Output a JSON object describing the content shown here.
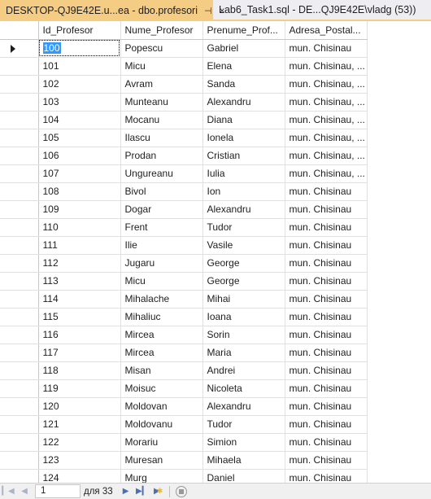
{
  "tabs": [
    {
      "label": "DESKTOP-QJ9E42E.u...ea - dbo.profesori",
      "pin": "⊣",
      "close": "×"
    },
    {
      "label": "Lab6_Task1.sql - DE...QJ9E42E\\vladg (53))"
    }
  ],
  "grid": {
    "columns": [
      "Id_Profesor",
      "Nume_Profesor",
      "Prenume_Prof...",
      "Adresa_Postal..."
    ],
    "rows": [
      [
        "100",
        "Popescu",
        "Gabriel",
        "mun. Chisinau"
      ],
      [
        "101",
        "Micu",
        "Elena",
        "mun. Chisinau, ..."
      ],
      [
        "102",
        "Avram",
        "Sanda",
        "mun. Chisinau, ..."
      ],
      [
        "103",
        "Munteanu",
        "Alexandru",
        "mun. Chisinau, ..."
      ],
      [
        "104",
        "Mocanu",
        "Diana",
        "mun. Chisinau, ..."
      ],
      [
        "105",
        "Ilascu",
        "Ionela",
        "mun. Chisinau, ..."
      ],
      [
        "106",
        "Prodan",
        "Cristian",
        "mun. Chisinau, ..."
      ],
      [
        "107",
        "Ungureanu",
        "Iulia",
        "mun. Chisinau, ..."
      ],
      [
        "108",
        "Bivol",
        "Ion",
        "mun. Chisinau"
      ],
      [
        "109",
        "Dogar",
        "Alexandru",
        "mun. Chisinau"
      ],
      [
        "110",
        "Frent",
        "Tudor",
        "mun. Chisinau"
      ],
      [
        "111",
        "Ilie",
        "Vasile",
        "mun. Chisinau"
      ],
      [
        "112",
        "Jugaru",
        "George",
        "mun. Chisinau"
      ],
      [
        "113",
        "Micu",
        "George",
        "mun. Chisinau"
      ],
      [
        "114",
        "Mihalache",
        "Mihai",
        "mun. Chisinau"
      ],
      [
        "115",
        "Mihaliuc",
        "Ioana",
        "mun. Chisinau"
      ],
      [
        "116",
        "Mircea",
        "Sorin",
        "mun. Chisinau"
      ],
      [
        "117",
        "Mircea",
        "Maria",
        "mun. Chisinau"
      ],
      [
        "118",
        "Misan",
        "Andrei",
        "mun. Chisinau"
      ],
      [
        "119",
        "Moisuc",
        "Nicoleta",
        "mun. Chisinau"
      ],
      [
        "120",
        "Moldovan",
        "Alexandru",
        "mun. Chisinau"
      ],
      [
        "121",
        "Moldovanu",
        "Tudor",
        "mun. Chisinau"
      ],
      [
        "122",
        "Morariu",
        "Simion",
        "mun. Chisinau"
      ],
      [
        "123",
        "Muresan",
        "Mihaela",
        "mun. Chisinau"
      ],
      [
        "124",
        "Murg",
        "Daniel",
        "mun. Chisinau"
      ]
    ],
    "current_row_index": 0
  },
  "navigation": {
    "current_page": "1",
    "page_text": "для 33",
    "icons": [
      "first-icon",
      "previous-icon",
      "next-icon",
      "last-icon",
      "new-row-icon",
      "stop-icon"
    ]
  },
  "colors": {
    "active_tab": "#f5cc84",
    "selection": "#3399ff",
    "nav_icon": "#4a6fb5"
  }
}
